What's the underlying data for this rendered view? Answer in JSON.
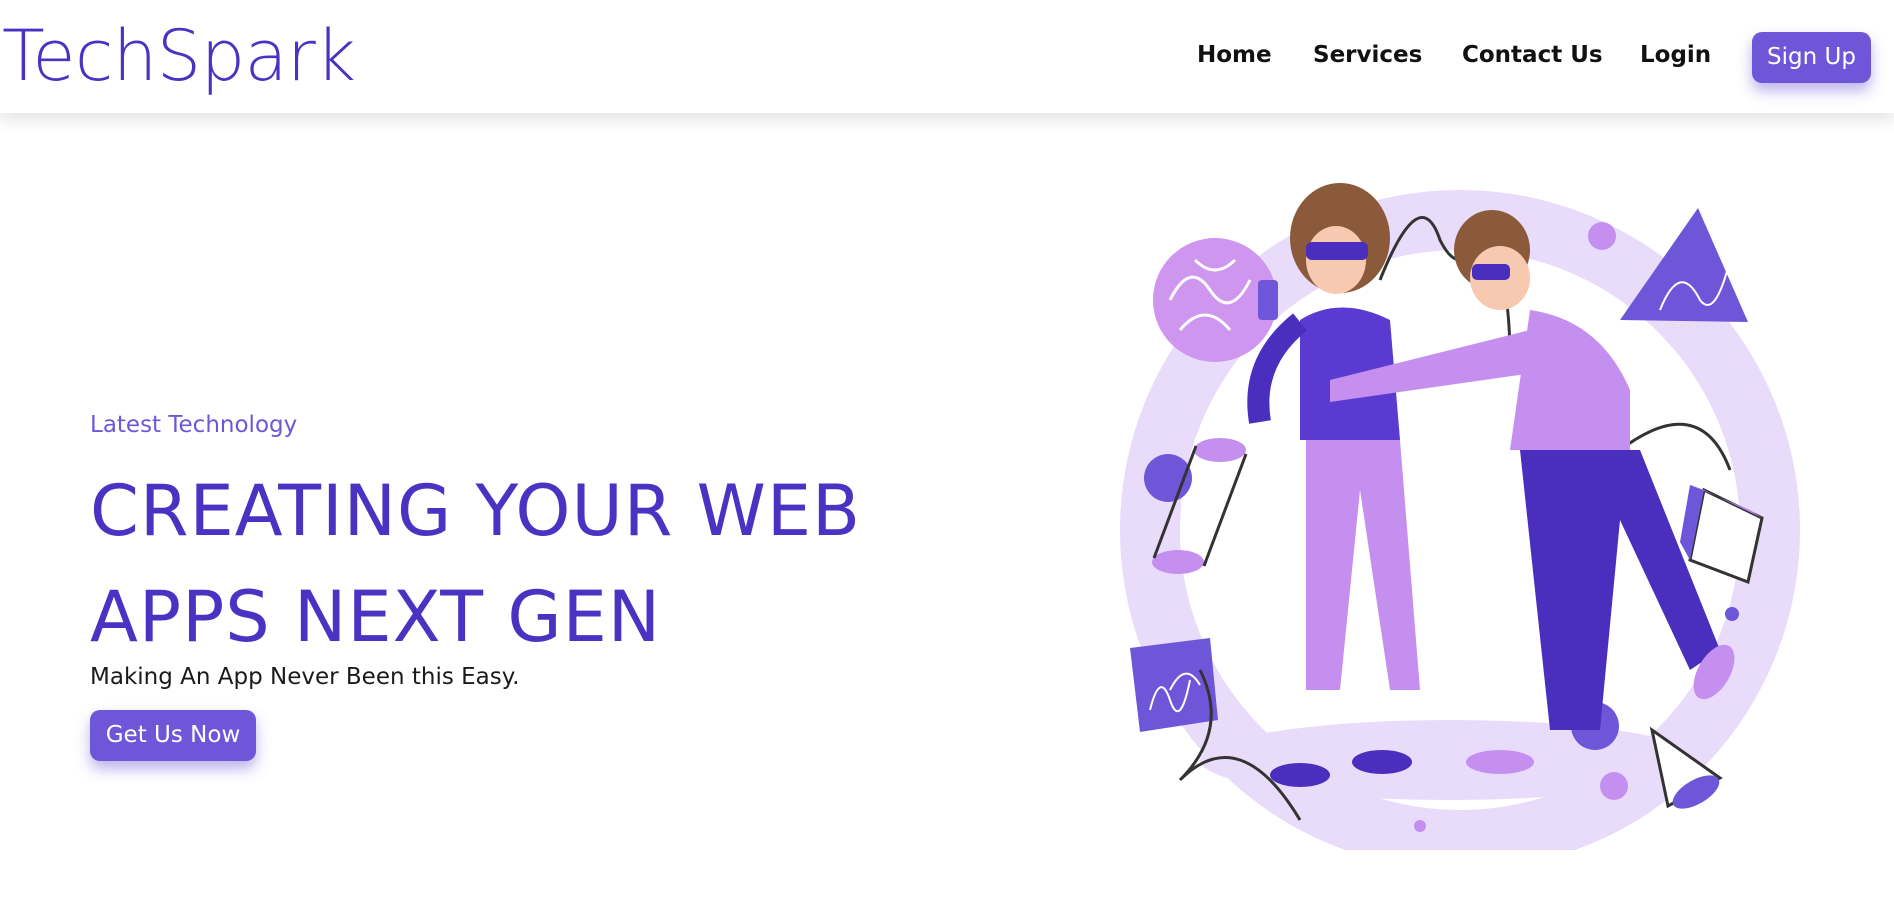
{
  "brand": {
    "name": "TechSpark"
  },
  "nav": {
    "items": [
      {
        "label": "Home"
      },
      {
        "label": "Services"
      },
      {
        "label": "Contact Us"
      },
      {
        "label": "Login"
      }
    ],
    "signup_label": "Sign Up"
  },
  "hero": {
    "eyebrow": "Latest Technology",
    "headline_line1": "CREATING YOUR WEB",
    "headline_line2": "APPS NEXT GEN",
    "subtitle": "Making An App Never Been this Easy.",
    "cta_label": "Get Us Now"
  },
  "illustration": {
    "icon": "vr-people-illustration"
  },
  "colors": {
    "brand": "#4b32c3",
    "accent": "#6e56d8",
    "light_purple": "#e9dcfa",
    "mid_purple": "#c58ff0",
    "dark_purple": "#4a2fbf"
  }
}
